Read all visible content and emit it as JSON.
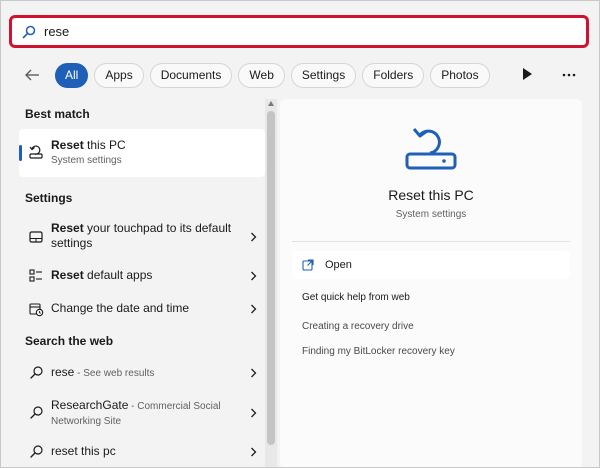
{
  "search": {
    "query": "rese"
  },
  "filters": {
    "items": [
      "All",
      "Apps",
      "Documents",
      "Web",
      "Settings",
      "Folders",
      "Photos"
    ]
  },
  "best_match": {
    "heading": "Best match",
    "name_bold": "Reset",
    "name_rest": " this PC",
    "subtitle": "System settings"
  },
  "settings": {
    "heading": "Settings",
    "items": [
      {
        "bold": "Reset",
        "rest": " your touchpad to its default",
        "line2": "settings"
      },
      {
        "bold": "Reset",
        "rest": " default apps"
      },
      {
        "bold": "",
        "rest": "Change the date and time"
      }
    ]
  },
  "web": {
    "heading": "Search the web",
    "items": [
      {
        "bold": "rese",
        "rest": " - See web results"
      },
      {
        "bold": "ResearchGate",
        "rest": " - Commercial Social",
        "line2": "Networking Site"
      },
      {
        "bold": "reset this pc",
        "rest": ""
      }
    ]
  },
  "preview": {
    "title": "Reset this PC",
    "subtitle": "System settings",
    "open_label": "Open",
    "help_heading": "Get quick help from web",
    "help_links": [
      "Creating a recovery drive",
      "Finding my BitLocker recovery key"
    ]
  },
  "colors": {
    "accent": "#1e5fb8",
    "highlight_border": "#d0122f"
  }
}
